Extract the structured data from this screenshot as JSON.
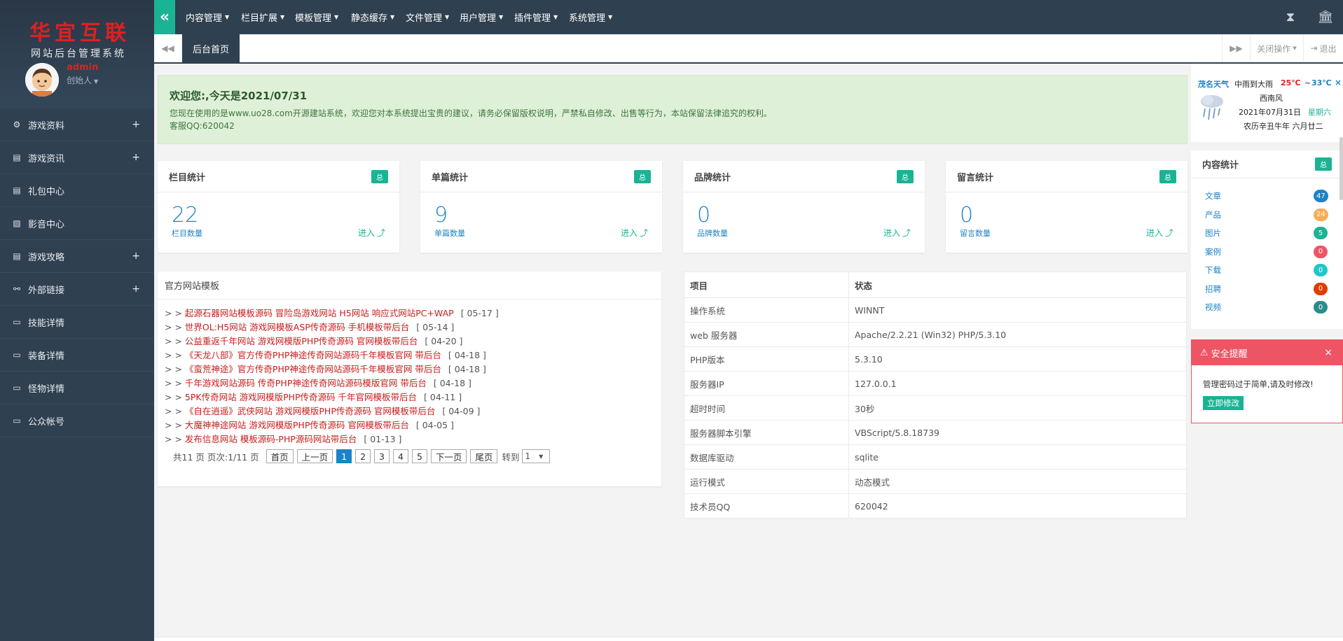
{
  "brand": {
    "title_a": "华宜",
    "title_b": "互联",
    "title_c": "",
    "subtitle": "网站后台管理系统",
    "user_name": "admin",
    "user_role": "创始人"
  },
  "sidebar": {
    "items": [
      {
        "label": "游戏资料",
        "icon": "sitemap-icon",
        "expandable": true
      },
      {
        "label": "游戏资讯",
        "icon": "newspaper-icon",
        "expandable": true
      },
      {
        "label": "礼包中心",
        "icon": "newspaper-icon",
        "expandable": false
      },
      {
        "label": "影音中心",
        "icon": "image-icon",
        "expandable": false
      },
      {
        "label": "游戏攻略",
        "icon": "newspaper-icon",
        "expandable": true
      },
      {
        "label": "外部链接",
        "icon": "link-icon",
        "expandable": true
      },
      {
        "label": "技能详情",
        "icon": "desktop-icon",
        "expandable": false
      },
      {
        "label": "装备详情",
        "icon": "desktop-icon",
        "expandable": false
      },
      {
        "label": "怪物详情",
        "icon": "desktop-icon",
        "expandable": false
      },
      {
        "label": "公众帐号",
        "icon": "desktop-icon",
        "expandable": false
      }
    ],
    "plus": "+"
  },
  "topnav": {
    "menus": [
      "内容管理",
      "栏目扩展",
      "模板管理",
      "静态缓存",
      "文件管理",
      "用户管理",
      "插件管理",
      "系统管理"
    ]
  },
  "tabs": {
    "home": "后台首页",
    "close_ops": "关闭操作",
    "logout": "退出"
  },
  "welcome": {
    "heading": "欢迎您:,今天是2021/07/31",
    "line1": "您现在使用的是www.uo28.com开源建站系统，欢迎您对本系统提出宝贵的建议，请务必保留版权说明，严禁私自修改、出售等行为，本站保留法律追究的权利。",
    "line2": "客服QQ:620042"
  },
  "stats": [
    {
      "title": "栏目统计",
      "badge": "总",
      "value": "22",
      "label": "栏目数量",
      "link": "进入"
    },
    {
      "title": "单篇统计",
      "badge": "总",
      "value": "9",
      "label": "单篇数量",
      "link": "进入"
    },
    {
      "title": "品牌统计",
      "badge": "总",
      "value": "0",
      "label": "品牌数量",
      "link": "进入"
    },
    {
      "title": "留言统计",
      "badge": "总",
      "value": "0",
      "label": "留言数量",
      "link": "进入"
    }
  ],
  "templates": {
    "title": "官方网站模板",
    "prefix": "> >",
    "items": [
      {
        "title": "起源石器网站模板源码 冒险岛游戏网站 H5网站 响应式网站PC+WAP",
        "date": "[ 05-17 ]"
      },
      {
        "title": "世界OL:H5网站 游戏网模板ASP传奇源码 手机模板带后台",
        "date": "[ 05-14 ]"
      },
      {
        "title": "公益重返千年网站 游戏网模版PHP传奇源码 官网模板带后台",
        "date": "[ 04-20 ]"
      },
      {
        "title": "《天龙八部》官方传奇PHP神途传奇网站源码千年模板官网 带后台",
        "date": "[ 04-18 ]"
      },
      {
        "title": "《蛮荒神途》官方传奇PHP神途传奇网站源码千年模板官网 带后台",
        "date": "[ 04-18 ]"
      },
      {
        "title": "千年游戏网站源码 传奇PHP神途传奇网站源码模版官网 带后台",
        "date": "[ 04-18 ]"
      },
      {
        "title": "5PK传奇网站 游戏网模版PHP传奇源码 千年官网模板带后台",
        "date": "[ 04-11 ]"
      },
      {
        "title": "《自在逍遥》武侠网站 游戏网模版PHP传奇源码 官网模板带后台",
        "date": "[ 04-09 ]"
      },
      {
        "title": "大魔神神途网站 游戏网模版PHP传奇源码 官网模板带后台",
        "date": "[ 04-05 ]"
      },
      {
        "title": "发布信息网站 模板源码-PHP源码网站带后台",
        "date": "[ 01-13 ]"
      }
    ],
    "pager": {
      "summary": "共11 页 页次:1/11 页",
      "first": "首页",
      "prev": "上一页",
      "pages": [
        "1",
        "2",
        "3",
        "4",
        "5"
      ],
      "next": "下一页",
      "last": "尾页",
      "goto": "转到",
      "select": "1"
    }
  },
  "server": {
    "headers": [
      "项目",
      "状态"
    ],
    "rows": [
      [
        "操作系统",
        "WINNT"
      ],
      [
        "web 服务器",
        "Apache/2.2.21 (Win32) PHP/5.3.10"
      ],
      [
        "PHP版本",
        "5.3.10"
      ],
      [
        "服务器IP",
        "127.0.0.1"
      ],
      [
        "超时时间",
        "30秒"
      ],
      [
        "服务器脚本引擎",
        "VBScript/5.8.18739"
      ],
      [
        "数据库驱动",
        "sqlite"
      ],
      [
        "运行模式",
        "动态模式"
      ],
      [
        "技术员QQ",
        "620042"
      ]
    ]
  },
  "weather": {
    "city": "茂名天气",
    "condition": "中雨到大雨",
    "temp_high": "25℃",
    "tilde": "~",
    "temp_low": "33℃",
    "close": "×",
    "wind": "西南风",
    "date": "2021年07月31日",
    "weekday": "星期六",
    "lunar": "农历辛丑牛年 六月廿二"
  },
  "content_stats": {
    "title": "内容统计",
    "badge": "总",
    "items": [
      {
        "label": "文章",
        "count": "47",
        "color": "#1c84c6"
      },
      {
        "label": "产品",
        "count": "24",
        "color": "#f8ac59"
      },
      {
        "label": "图片",
        "count": "5",
        "color": "#1ab394"
      },
      {
        "label": "案例",
        "count": "0",
        "color": "#ed5565"
      },
      {
        "label": "下载",
        "count": "0",
        "color": "#23c6c8"
      },
      {
        "label": "招聘",
        "count": "0",
        "color": "#e03b00"
      },
      {
        "label": "视频",
        "count": "0",
        "color": "#2a8c8c"
      }
    ]
  },
  "security": {
    "title": "安全提醒",
    "close": "×",
    "message": "管理密码过于简单,请及时修改!",
    "button": "立即修改"
  }
}
